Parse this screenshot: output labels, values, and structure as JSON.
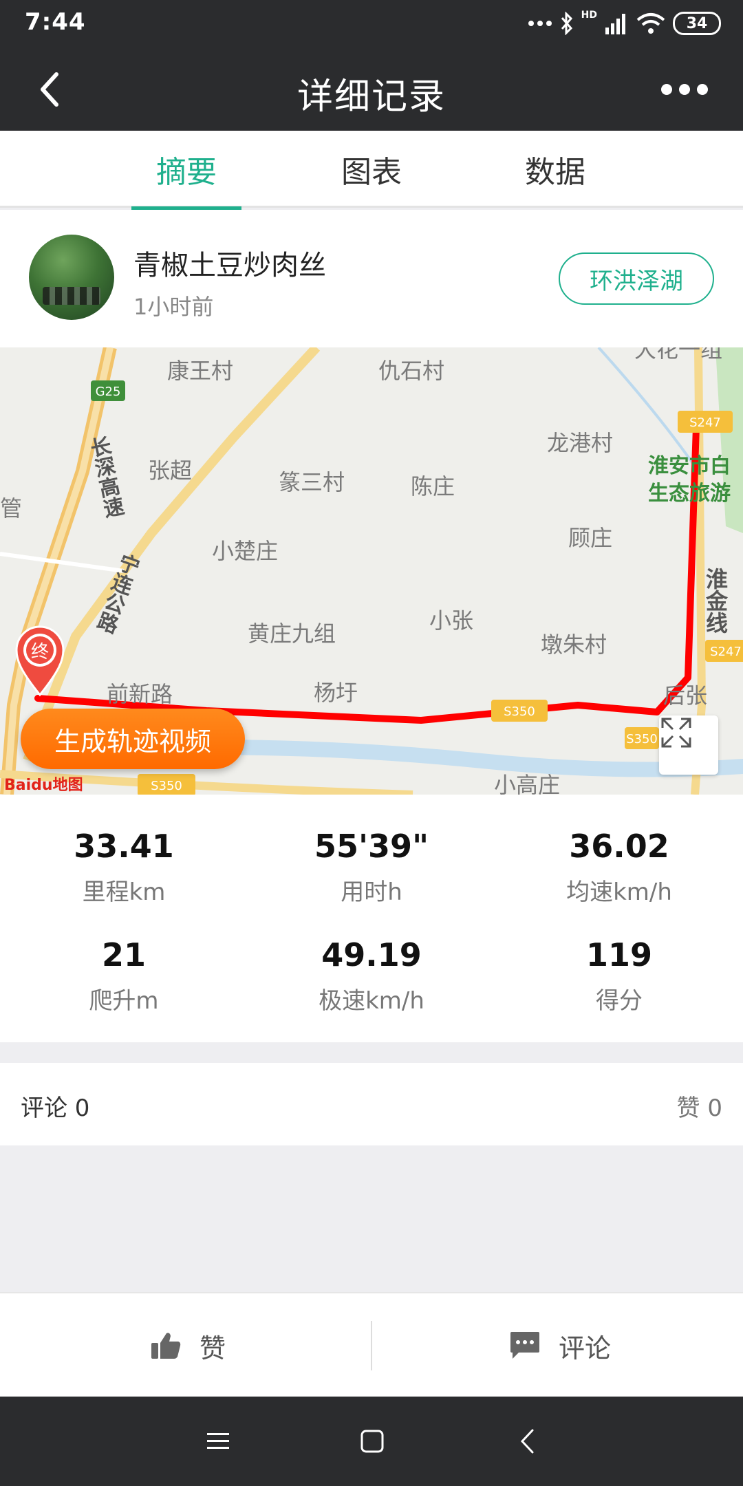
{
  "status_bar": {
    "time": "7:44",
    "network": "HD",
    "battery": "34"
  },
  "header": {
    "title": "详细记录"
  },
  "tabs": [
    {
      "label": "摘要",
      "active": true
    },
    {
      "label": "图表",
      "active": false
    },
    {
      "label": "数据",
      "active": false
    }
  ],
  "user": {
    "name": "青椒土豆炒肉丝",
    "time_ago": "1小时前",
    "route_tag": "环洪泽湖"
  },
  "map": {
    "route_color": "#ff0000",
    "end_marker": "终",
    "generate_video_label": "生成轨迹视频",
    "logo": "Baidu地图",
    "place_labels": [
      "康王村",
      "仇石村",
      "张超",
      "篆三村",
      "陈庄",
      "龙港村",
      "小楚庄",
      "顾庄",
      "黄庄九组",
      "小张",
      "墩朱村",
      "杨圩",
      "小高庄",
      "大花一组",
      "淮安市白",
      "生态旅游",
      "淮金线",
      "长深高速",
      "宁连公路",
      "管",
      "前新路",
      "后张"
    ],
    "road_shields": [
      "G25",
      "S247",
      "S247",
      "S350",
      "S350",
      "S350"
    ]
  },
  "stats": [
    {
      "value": "33.41",
      "label": "里程km"
    },
    {
      "value": "55'39\"",
      "label": "用时h"
    },
    {
      "value": "36.02",
      "label": "均速km/h"
    },
    {
      "value": "21",
      "label": "爬升m"
    },
    {
      "value": "49.19",
      "label": "极速km/h"
    },
    {
      "value": "119",
      "label": "得分"
    }
  ],
  "comments": {
    "comment_label": "评论 0",
    "like_label": "赞 0"
  },
  "actions": {
    "like": "赞",
    "comment": "评论"
  },
  "colors": {
    "accent": "#1fb08d",
    "header_bg": "#2b2c2e",
    "video_button": "#ff7a10"
  }
}
